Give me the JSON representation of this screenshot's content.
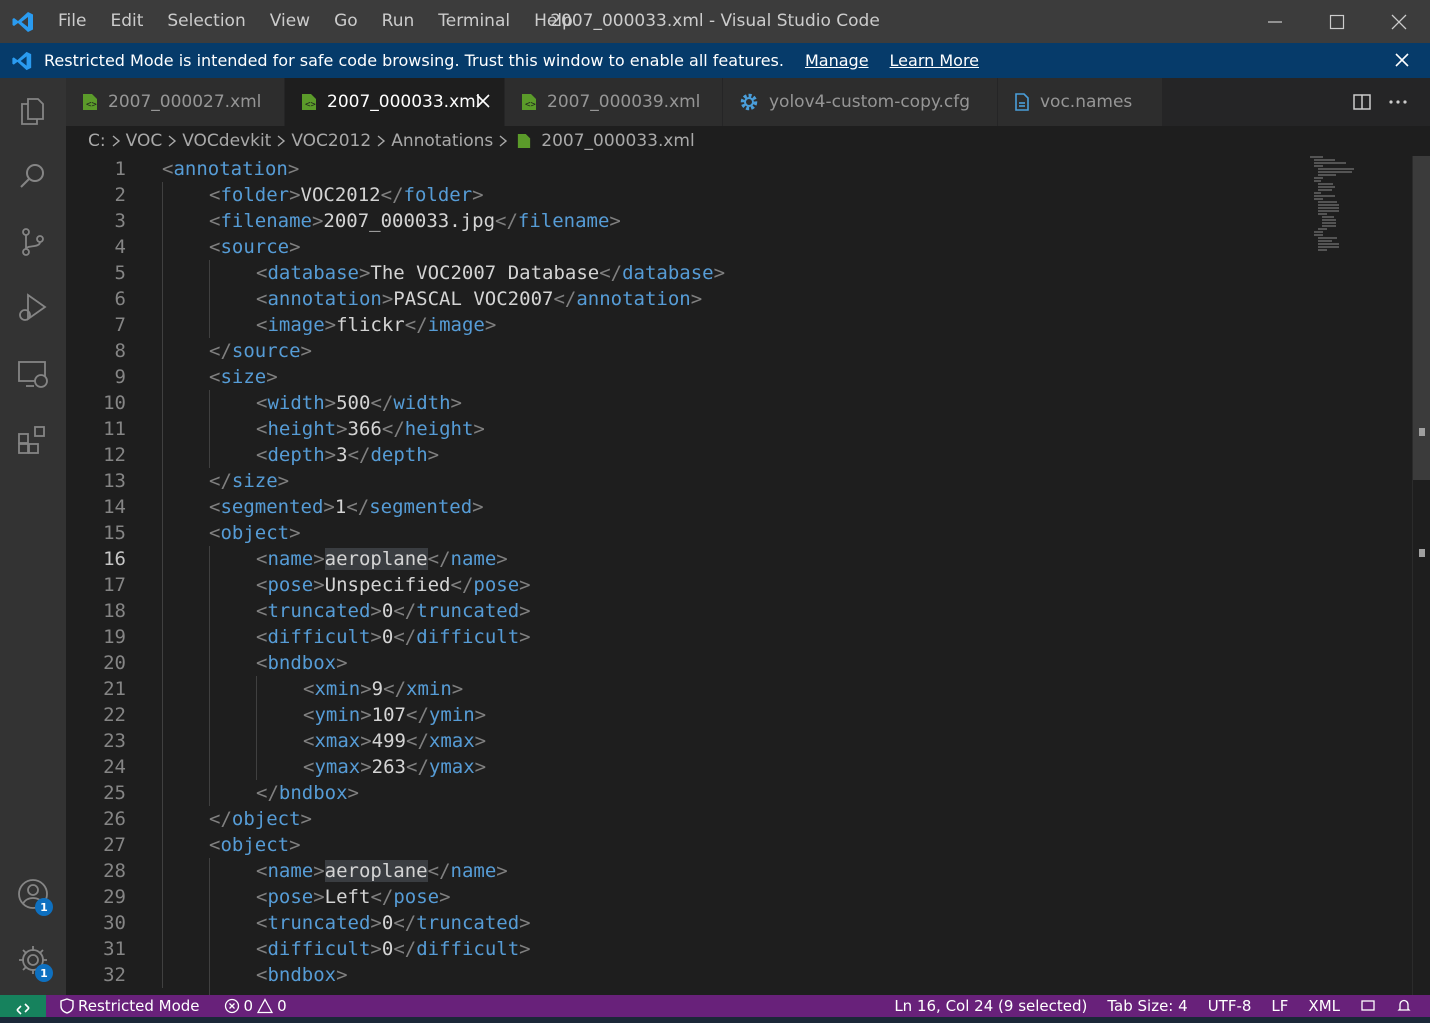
{
  "window": {
    "title": "2007_000033.xml - Visual Studio Code",
    "menu": [
      "File",
      "Edit",
      "Selection",
      "View",
      "Go",
      "Run",
      "Terminal",
      "Help"
    ]
  },
  "banner": {
    "text": "Restricted Mode is intended for safe code browsing. Trust this window to enable all features.",
    "manage_label": "Manage",
    "learn_more_label": "Learn More"
  },
  "activity_bar": {
    "icons": [
      "explorer-icon",
      "search-icon",
      "source-control-icon",
      "run-debug-icon",
      "remote-explorer-icon",
      "extensions-icon"
    ],
    "accounts_badge": "1",
    "settings_badge": "1"
  },
  "tabs": [
    {
      "label": "2007_000027.xml",
      "icon": "xml-file-icon",
      "active": false
    },
    {
      "label": "2007_000033.xml",
      "icon": "xml-file-icon",
      "active": true
    },
    {
      "label": "2007_000039.xml",
      "icon": "xml-file-icon",
      "active": false
    },
    {
      "label": "yolov4-custom-copy.cfg",
      "icon": "gear-icon",
      "active": false
    },
    {
      "label": "voc.names",
      "icon": "file-icon",
      "active": false
    }
  ],
  "breadcrumb": [
    "C:",
    "VOC",
    "VOCdevkit",
    "VOC2012",
    "Annotations",
    "2007_000033.xml"
  ],
  "editor": {
    "current_line": 16,
    "lines": [
      {
        "n": "1",
        "indent": 0,
        "open": "annotation",
        "text": "",
        "close": ""
      },
      {
        "n": "2",
        "indent": 1,
        "open": "folder",
        "text": "VOC2012",
        "close": "folder"
      },
      {
        "n": "3",
        "indent": 1,
        "open": "filename",
        "text": "2007_000033.jpg",
        "close": "filename"
      },
      {
        "n": "4",
        "indent": 1,
        "open": "source",
        "text": "",
        "close": ""
      },
      {
        "n": "5",
        "indent": 2,
        "open": "database",
        "text": "The VOC2007 Database",
        "close": "database"
      },
      {
        "n": "6",
        "indent": 2,
        "open": "annotation",
        "text": "PASCAL VOC2007",
        "close": "annotation"
      },
      {
        "n": "7",
        "indent": 2,
        "open": "image",
        "text": "flickr",
        "close": "image"
      },
      {
        "n": "8",
        "indent": 1,
        "open": "",
        "text": "",
        "close": "source"
      },
      {
        "n": "9",
        "indent": 1,
        "open": "size",
        "text": "",
        "close": ""
      },
      {
        "n": "10",
        "indent": 2,
        "open": "width",
        "text": "500",
        "close": "width"
      },
      {
        "n": "11",
        "indent": 2,
        "open": "height",
        "text": "366",
        "close": "height"
      },
      {
        "n": "12",
        "indent": 2,
        "open": "depth",
        "text": "3",
        "close": "depth"
      },
      {
        "n": "13",
        "indent": 1,
        "open": "",
        "text": "",
        "close": "size"
      },
      {
        "n": "14",
        "indent": 1,
        "open": "segmented",
        "text": "1",
        "close": "segmented"
      },
      {
        "n": "15",
        "indent": 1,
        "open": "object",
        "text": "",
        "close": ""
      },
      {
        "n": "16",
        "indent": 2,
        "open": "name",
        "text": "aeroplane",
        "close": "name",
        "highlight": true
      },
      {
        "n": "17",
        "indent": 2,
        "open": "pose",
        "text": "Unspecified",
        "close": "pose"
      },
      {
        "n": "18",
        "indent": 2,
        "open": "truncated",
        "text": "0",
        "close": "truncated"
      },
      {
        "n": "19",
        "indent": 2,
        "open": "difficult",
        "text": "0",
        "close": "difficult"
      },
      {
        "n": "20",
        "indent": 2,
        "open": "bndbox",
        "text": "",
        "close": ""
      },
      {
        "n": "21",
        "indent": 3,
        "open": "xmin",
        "text": "9",
        "close": "xmin"
      },
      {
        "n": "22",
        "indent": 3,
        "open": "ymin",
        "text": "107",
        "close": "ymin"
      },
      {
        "n": "23",
        "indent": 3,
        "open": "xmax",
        "text": "499",
        "close": "xmax"
      },
      {
        "n": "24",
        "indent": 3,
        "open": "ymax",
        "text": "263",
        "close": "ymax"
      },
      {
        "n": "25",
        "indent": 2,
        "open": "",
        "text": "",
        "close": "bndbox"
      },
      {
        "n": "26",
        "indent": 1,
        "open": "",
        "text": "",
        "close": "object"
      },
      {
        "n": "27",
        "indent": 1,
        "open": "object",
        "text": "",
        "close": ""
      },
      {
        "n": "28",
        "indent": 2,
        "open": "name",
        "text": "aeroplane",
        "close": "name",
        "highlight": true
      },
      {
        "n": "29",
        "indent": 2,
        "open": "pose",
        "text": "Left",
        "close": "pose"
      },
      {
        "n": "30",
        "indent": 2,
        "open": "truncated",
        "text": "0",
        "close": "truncated"
      },
      {
        "n": "31",
        "indent": 2,
        "open": "difficult",
        "text": "0",
        "close": "difficult"
      },
      {
        "n": "32",
        "indent": 2,
        "open": "bndbox",
        "text": "",
        "close": ""
      }
    ]
  },
  "statusbar": {
    "restricted_label": "Restricted Mode",
    "errors": "0",
    "warnings": "0",
    "position": "Ln 16, Col 24 (9 selected)",
    "tab_size": "Tab Size: 4",
    "encoding": "UTF-8",
    "eol": "LF",
    "language": "XML"
  },
  "colors": {
    "tag": "#569cd6",
    "bracket": "#808080",
    "text": "#d4d4d4",
    "banner_bg": "#063b6a",
    "statusbar_bg": "#68217a",
    "remote_bg": "#16825d",
    "badge": "#0e70c0"
  }
}
